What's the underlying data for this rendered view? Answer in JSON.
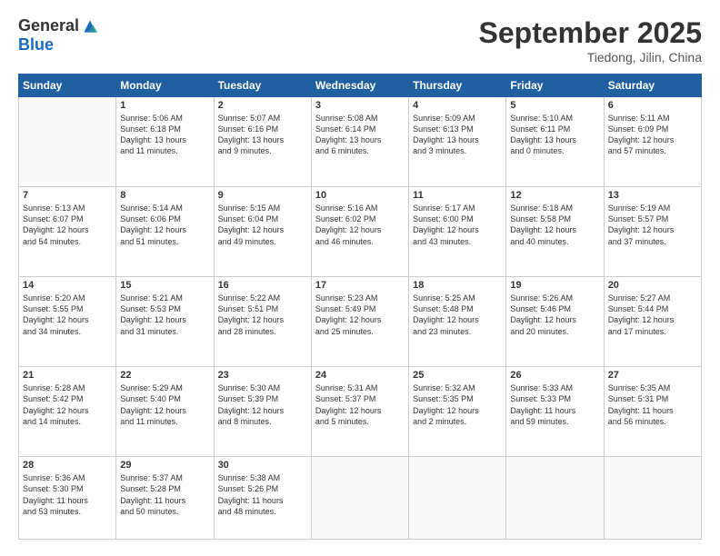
{
  "header": {
    "logo_general": "General",
    "logo_blue": "Blue",
    "month_title": "September 2025",
    "subtitle": "Tiedong, Jilin, China"
  },
  "weekdays": [
    "Sunday",
    "Monday",
    "Tuesday",
    "Wednesday",
    "Thursday",
    "Friday",
    "Saturday"
  ],
  "weeks": [
    [
      {
        "day": "",
        "info": ""
      },
      {
        "day": "1",
        "info": "Sunrise: 5:06 AM\nSunset: 6:18 PM\nDaylight: 13 hours\nand 11 minutes."
      },
      {
        "day": "2",
        "info": "Sunrise: 5:07 AM\nSunset: 6:16 PM\nDaylight: 13 hours\nand 9 minutes."
      },
      {
        "day": "3",
        "info": "Sunrise: 5:08 AM\nSunset: 6:14 PM\nDaylight: 13 hours\nand 6 minutes."
      },
      {
        "day": "4",
        "info": "Sunrise: 5:09 AM\nSunset: 6:13 PM\nDaylight: 13 hours\nand 3 minutes."
      },
      {
        "day": "5",
        "info": "Sunrise: 5:10 AM\nSunset: 6:11 PM\nDaylight: 13 hours\nand 0 minutes."
      },
      {
        "day": "6",
        "info": "Sunrise: 5:11 AM\nSunset: 6:09 PM\nDaylight: 12 hours\nand 57 minutes."
      }
    ],
    [
      {
        "day": "7",
        "info": "Sunrise: 5:13 AM\nSunset: 6:07 PM\nDaylight: 12 hours\nand 54 minutes."
      },
      {
        "day": "8",
        "info": "Sunrise: 5:14 AM\nSunset: 6:06 PM\nDaylight: 12 hours\nand 51 minutes."
      },
      {
        "day": "9",
        "info": "Sunrise: 5:15 AM\nSunset: 6:04 PM\nDaylight: 12 hours\nand 49 minutes."
      },
      {
        "day": "10",
        "info": "Sunrise: 5:16 AM\nSunset: 6:02 PM\nDaylight: 12 hours\nand 46 minutes."
      },
      {
        "day": "11",
        "info": "Sunrise: 5:17 AM\nSunset: 6:00 PM\nDaylight: 12 hours\nand 43 minutes."
      },
      {
        "day": "12",
        "info": "Sunrise: 5:18 AM\nSunset: 5:58 PM\nDaylight: 12 hours\nand 40 minutes."
      },
      {
        "day": "13",
        "info": "Sunrise: 5:19 AM\nSunset: 5:57 PM\nDaylight: 12 hours\nand 37 minutes."
      }
    ],
    [
      {
        "day": "14",
        "info": "Sunrise: 5:20 AM\nSunset: 5:55 PM\nDaylight: 12 hours\nand 34 minutes."
      },
      {
        "day": "15",
        "info": "Sunrise: 5:21 AM\nSunset: 5:53 PM\nDaylight: 12 hours\nand 31 minutes."
      },
      {
        "day": "16",
        "info": "Sunrise: 5:22 AM\nSunset: 5:51 PM\nDaylight: 12 hours\nand 28 minutes."
      },
      {
        "day": "17",
        "info": "Sunrise: 5:23 AM\nSunset: 5:49 PM\nDaylight: 12 hours\nand 25 minutes."
      },
      {
        "day": "18",
        "info": "Sunrise: 5:25 AM\nSunset: 5:48 PM\nDaylight: 12 hours\nand 23 minutes."
      },
      {
        "day": "19",
        "info": "Sunrise: 5:26 AM\nSunset: 5:46 PM\nDaylight: 12 hours\nand 20 minutes."
      },
      {
        "day": "20",
        "info": "Sunrise: 5:27 AM\nSunset: 5:44 PM\nDaylight: 12 hours\nand 17 minutes."
      }
    ],
    [
      {
        "day": "21",
        "info": "Sunrise: 5:28 AM\nSunset: 5:42 PM\nDaylight: 12 hours\nand 14 minutes."
      },
      {
        "day": "22",
        "info": "Sunrise: 5:29 AM\nSunset: 5:40 PM\nDaylight: 12 hours\nand 11 minutes."
      },
      {
        "day": "23",
        "info": "Sunrise: 5:30 AM\nSunset: 5:39 PM\nDaylight: 12 hours\nand 8 minutes."
      },
      {
        "day": "24",
        "info": "Sunrise: 5:31 AM\nSunset: 5:37 PM\nDaylight: 12 hours\nand 5 minutes."
      },
      {
        "day": "25",
        "info": "Sunrise: 5:32 AM\nSunset: 5:35 PM\nDaylight: 12 hours\nand 2 minutes."
      },
      {
        "day": "26",
        "info": "Sunrise: 5:33 AM\nSunset: 5:33 PM\nDaylight: 11 hours\nand 59 minutes."
      },
      {
        "day": "27",
        "info": "Sunrise: 5:35 AM\nSunset: 5:31 PM\nDaylight: 11 hours\nand 56 minutes."
      }
    ],
    [
      {
        "day": "28",
        "info": "Sunrise: 5:36 AM\nSunset: 5:30 PM\nDaylight: 11 hours\nand 53 minutes."
      },
      {
        "day": "29",
        "info": "Sunrise: 5:37 AM\nSunset: 5:28 PM\nDaylight: 11 hours\nand 50 minutes."
      },
      {
        "day": "30",
        "info": "Sunrise: 5:38 AM\nSunset: 5:26 PM\nDaylight: 11 hours\nand 48 minutes."
      },
      {
        "day": "",
        "info": ""
      },
      {
        "day": "",
        "info": ""
      },
      {
        "day": "",
        "info": ""
      },
      {
        "day": "",
        "info": ""
      }
    ]
  ]
}
